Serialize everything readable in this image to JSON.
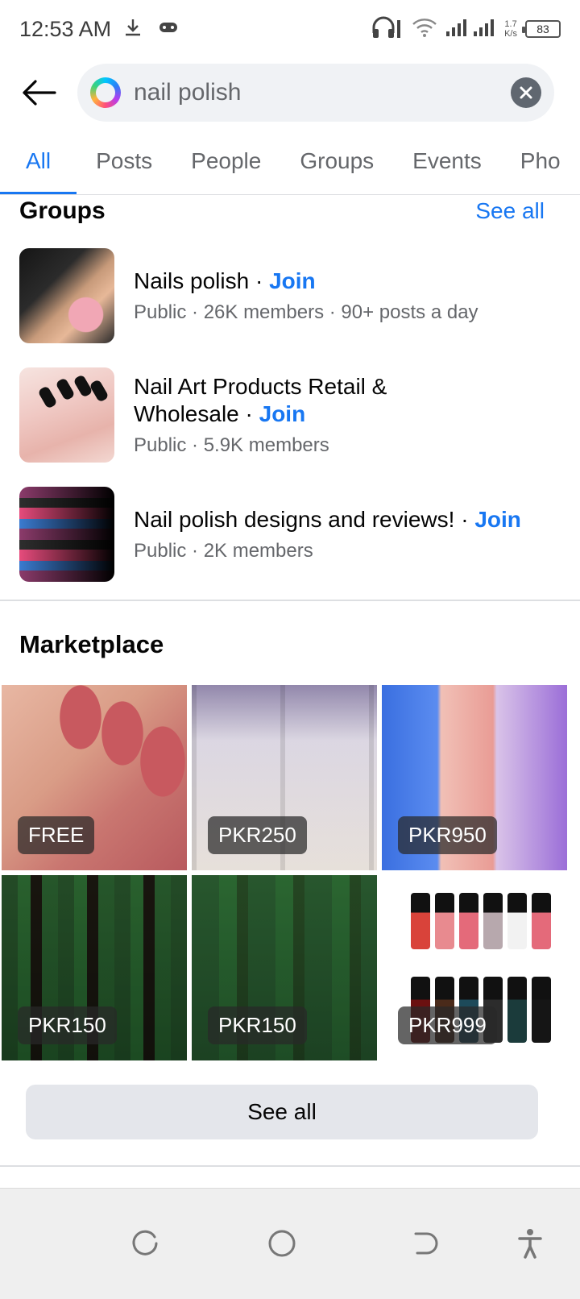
{
  "status_bar": {
    "time": "12:53 AM",
    "net_speed_value": "1.7",
    "net_speed_unit": "K/s",
    "battery": "83",
    "icons": [
      "download-icon",
      "game-controller-icon",
      "headphones-icon",
      "wifi-icon",
      "signal-icon",
      "battery-icon"
    ]
  },
  "search": {
    "query": "nail polish",
    "placeholder": "Search"
  },
  "tabs": [
    {
      "label": "All",
      "active": true
    },
    {
      "label": "Posts",
      "active": false
    },
    {
      "label": "People",
      "active": false
    },
    {
      "label": "Groups",
      "active": false
    },
    {
      "label": "Events",
      "active": false
    },
    {
      "label": "Pho",
      "active": false
    }
  ],
  "groups_section": {
    "title": "Groups",
    "see_all": "See all",
    "items": [
      {
        "name": "Nails polish",
        "sep": " · ",
        "join": "Join",
        "meta": "Public · 26K members · 90+ posts a day"
      },
      {
        "name": "Nail Art Products Retail & Wholesale",
        "sep": " · ",
        "join": "Join",
        "meta": "Public · 5.9K members"
      },
      {
        "name": "Nail polish designs and reviews!",
        "sep": " · ",
        "join": "Join",
        "meta": "Public · 2K members"
      }
    ]
  },
  "marketplace": {
    "title": "Marketplace",
    "items": [
      {
        "price": "FREE"
      },
      {
        "price": "PKR250"
      },
      {
        "price": "PKR950"
      },
      {
        "price": "PKR150"
      },
      {
        "price": "PKR150"
      },
      {
        "price": "PKR999"
      }
    ],
    "see_all": "See all"
  },
  "colors": {
    "accent": "#1877f2",
    "muted_text": "#65676b",
    "button_bg": "#e4e6eb"
  }
}
